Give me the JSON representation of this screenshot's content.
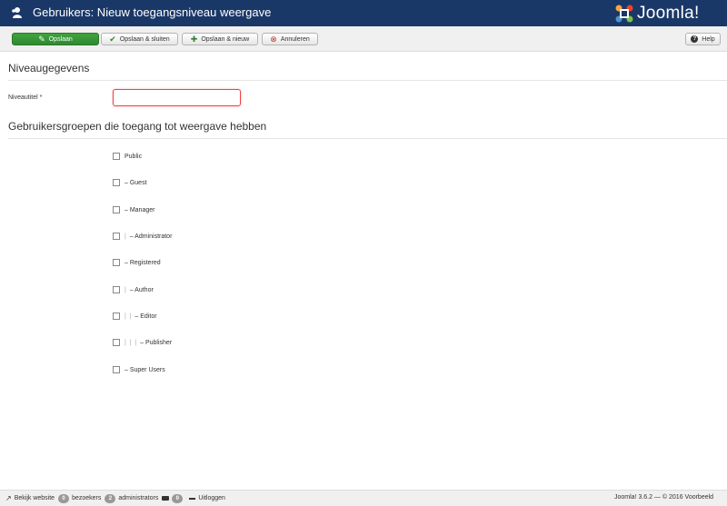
{
  "header": {
    "title": "Gebruikers: Nieuw toegangsniveau weergave",
    "title_icon": "users-icon",
    "logo_text": "Joomla!",
    "logo_icon": "joomla-logo-icon"
  },
  "toolbar": {
    "save_label": "Opslaan",
    "save_close_label": "Opslaan & sluiten",
    "save_new_label": "Opslaan & nieuw",
    "cancel_label": "Annuleren",
    "help_label": "Help",
    "save_icon": "edit-icon",
    "save_close_icon": "check-icon",
    "save_new_icon": "plus-icon",
    "cancel_icon": "cancel-circle-icon",
    "help_icon": "question-circle-icon",
    "colors": {
      "success": "#378137",
      "danger": "#bd362f"
    }
  },
  "section1": {
    "title": "Niveaugegevens"
  },
  "form": {
    "level_title_label": "Niveautitel *",
    "level_title_value": ""
  },
  "section2": {
    "title": "Gebruikersgroepen die toegang tot weergave hebben"
  },
  "groups": [
    {
      "prefix": "",
      "label": "Public"
    },
    {
      "prefix": "",
      "label": "– Guest"
    },
    {
      "prefix": "",
      "label": "– Manager"
    },
    {
      "prefix": "|  ",
      "label": "– Administrator"
    },
    {
      "prefix": "",
      "label": "– Registered"
    },
    {
      "prefix": "|  ",
      "label": "– Author"
    },
    {
      "prefix": "|  |  ",
      "label": "– Editor"
    },
    {
      "prefix": "|  |  |  ",
      "label": "– Publisher"
    },
    {
      "prefix": "",
      "label": "– Super Users"
    }
  ],
  "statusbar": {
    "view_site_label": "Bekijk website",
    "visitors_count": "0",
    "visitors_label": "bezoekers",
    "admins_count": "2",
    "admins_label": "administrators",
    "messages_count": "0",
    "logout_label": "Uitloggen",
    "copyright": "Joomla! 3.6.2 — © 2016 Voorbeeld"
  },
  "colors": {
    "header_bg": "#1a3867",
    "toolbar_bg": "#f0f0f0",
    "input_error_border": "#e44"
  }
}
